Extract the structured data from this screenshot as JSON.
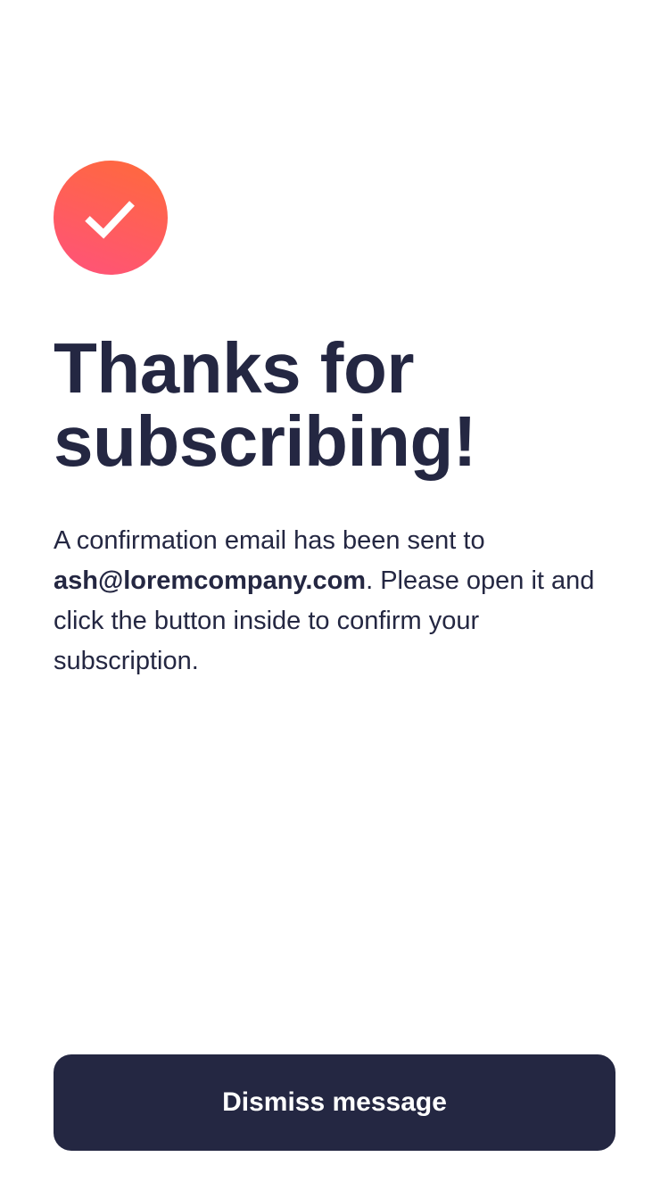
{
  "icon": {
    "name": "checkmark-icon",
    "gradient_start": "#ff6a3a",
    "gradient_end": "#ff527b",
    "check_color": "#ffffff"
  },
  "title": {
    "line1": "Thanks for",
    "line2": "subscribing!"
  },
  "message": {
    "intro": "A confirmation email has been sent to ",
    "email": "ash@loremcompany.com",
    "outro": ". Please open it and click the button inside to confirm your subscription."
  },
  "button": {
    "label": "Dismiss message"
  },
  "colors": {
    "text": "#242742",
    "button_bg": "#242742",
    "button_text": "#ffffff",
    "background": "#ffffff"
  }
}
